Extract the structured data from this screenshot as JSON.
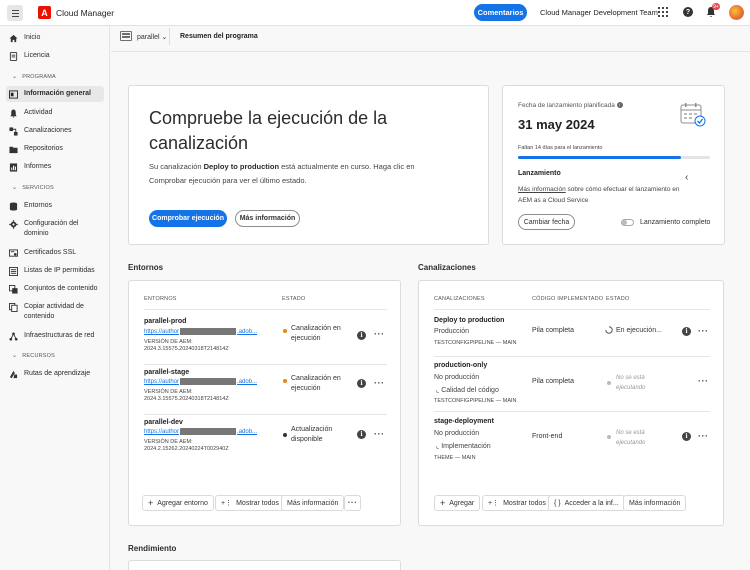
{
  "header": {
    "app_title": "Cloud Manager",
    "feedback_label": "Comentarios",
    "org_name": "Cloud Manager Development Team",
    "notification_count": "9+"
  },
  "sidebar": {
    "items_top": [
      {
        "label": "Inicio",
        "icon": "home-icon"
      },
      {
        "label": "Licencia",
        "icon": "license-icon"
      }
    ],
    "programa_title": "PROGRAMA",
    "programa_items": [
      {
        "label": "Información general",
        "icon": "overview-icon"
      },
      {
        "label": "Actividad",
        "icon": "bell-icon"
      },
      {
        "label": "Canalizaciones",
        "icon": "pipeline-icon"
      },
      {
        "label": "Repositorios",
        "icon": "folder-icon"
      },
      {
        "label": "Informes",
        "icon": "report-icon"
      }
    ],
    "servicios_title": "SERVICIOS",
    "servicios_items": [
      {
        "label": "Entornos",
        "icon": "environments-icon"
      },
      {
        "label": "Configuración del dominio",
        "icon": "gear-icon"
      },
      {
        "label": "Certificados SSL",
        "icon": "certificate-icon"
      },
      {
        "label": "Listas de IP permitidas",
        "icon": "list-icon"
      },
      {
        "label": "Conjuntos de contenido",
        "icon": "content-set-icon"
      },
      {
        "label": "Copiar actividad de contenido",
        "icon": "copy-icon"
      },
      {
        "label": "Infraestructuras de red",
        "icon": "network-icon"
      }
    ],
    "recursos_title": "RECURSOS",
    "recursos_items": [
      {
        "label": "Rutas de aprendizaje",
        "icon": "learning-icon"
      }
    ]
  },
  "breadcrumb": {
    "program": "parallel",
    "page": "Resumen del programa"
  },
  "hero": {
    "title": "Compruebe la ejecución de la canalización",
    "body_prefix": "Su canalización ",
    "body_pipeline": "Deploy to production",
    "body_suffix": " está actualmente en curso. Haga clic en Comprobar ejecución para ver el último estado.",
    "primary_button": "Comprobar ejecución",
    "secondary_button": "Más información"
  },
  "launch": {
    "date_label": "Fecha de lanzamiento planificada",
    "date": "31 may 2024",
    "days_left": "Faltan 14 días para el lanzamiento",
    "progress": 0.85,
    "section_title": "Lanzamiento",
    "info_link": "Más información",
    "info_text": " sobre cómo efectuar el lanzamiento en AEM as a Cloud Service",
    "change_date_button": "Cambiar fecha",
    "toggle_label": "Lanzamiento completo"
  },
  "environments": {
    "heading": "Entornos",
    "col_env": "ENTORNOS",
    "col_status": "ESTADO",
    "rows": [
      {
        "name": "parallel-prod",
        "link_start": "https://author",
        "link_end": ".adob...",
        "version_label": "VERSIÓN DE AEM:",
        "version": "2024.3.15575.20240318T214814Z",
        "status": "Canalización en ejecución",
        "dot_color": "#e68619"
      },
      {
        "name": "parallel-stage",
        "link_start": "https://author",
        "link_end": ".adob...",
        "version_label": "VERSIÓN DE AEM:",
        "version": "2024.3.15575.20240318T214814Z",
        "status": "Canalización en ejecución",
        "dot_color": "#e68619"
      },
      {
        "name": "parallel-dev",
        "link_start": "https://author",
        "link_end": ".adob...",
        "version_label": "VERSIÓN DE AEM:",
        "version": "2024.2.15262.20240224T002940Z",
        "status": "Actualización disponible",
        "dot_color": "#333333"
      }
    ],
    "footer": {
      "add": "Agregar entorno",
      "show_all": "Mostrar todos",
      "more_info": "Más información"
    }
  },
  "pipelines": {
    "heading": "Canalizaciones",
    "col_pipeline": "CANALIZACIONES",
    "col_code": "CÓDIGO IMPLEMENTADO",
    "col_status": "ESTADO",
    "rows": [
      {
        "name": "Deploy to production",
        "type": "Producción",
        "sub": "",
        "meta": "TESTCONFIGPIPELINE — MAIN",
        "code": "Pila completa",
        "status": "En ejecución...",
        "has_info": true
      },
      {
        "name": "production-only",
        "type": "No producción",
        "sub": "Calidad del código",
        "meta": "TESTCONFIGPIPELINE — MAIN",
        "code": "Pila completa",
        "status": "No se está ejecutando",
        "has_info": false
      },
      {
        "name": "stage-deployment",
        "type": "No producción",
        "sub": "Implementación",
        "meta": "THEME — MAIN",
        "code": "Front-end",
        "status": "No se está ejecutando",
        "has_info": true
      }
    ],
    "footer": {
      "add": "Agregar",
      "show_all": "Mostrar todos",
      "access": "Acceder a la inf...",
      "more_info": "Más información"
    }
  },
  "performance": {
    "heading": "Rendimiento"
  },
  "colors": {
    "accent": "#1473e6",
    "brand": "#eb1000"
  }
}
